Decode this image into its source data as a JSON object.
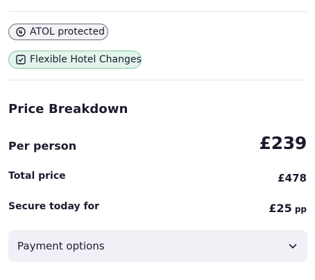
{
  "badges": {
    "atol": {
      "label": "ATOL protected",
      "icon": "atol-shield-icon"
    },
    "flexible": {
      "label": "Flexible Hotel Changes",
      "icon": "checkbox-icon"
    }
  },
  "price_breakdown": {
    "title": "Price Breakdown",
    "per_person": {
      "label": "Per person",
      "value": "£239"
    },
    "total_price": {
      "label": "Total price",
      "value": "£478"
    },
    "secure_today": {
      "label": "Secure today for",
      "value": "£25",
      "unit": "pp"
    }
  },
  "payment_options": {
    "label": "Payment options",
    "icon": "chevron-down-icon"
  },
  "colors": {
    "atol_badge_bg": "#f3f2f6",
    "flex_badge_bg": "#e3f4eb",
    "flex_badge_border": "#7fc8a2",
    "panel_bg": "#f1f0f7",
    "text": "#1b1b2e"
  }
}
